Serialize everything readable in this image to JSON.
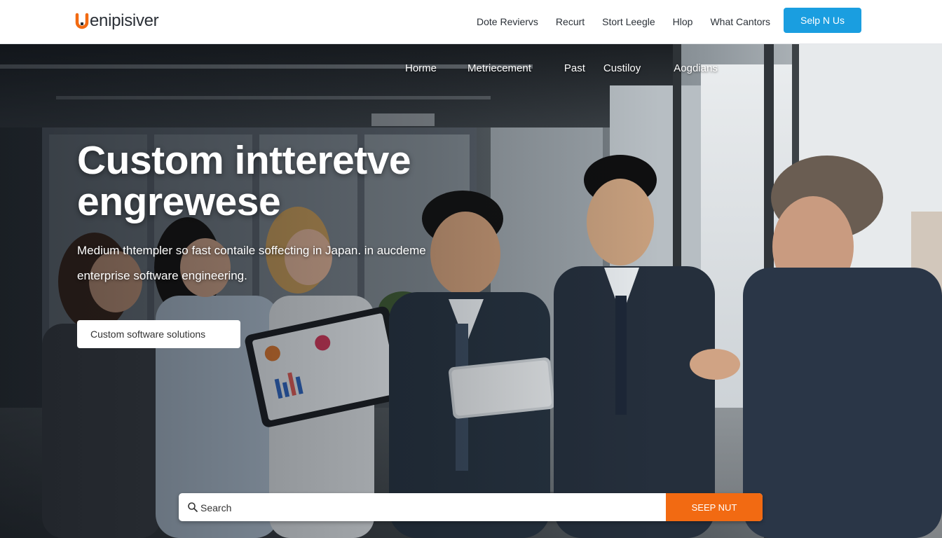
{
  "header": {
    "logo_text": "enipisiver",
    "nav": [
      "Dote Reviervs",
      "Recurt",
      "Stort Leegle",
      "Hlop",
      "What Cantors"
    ],
    "cta_label": "Selp N Us"
  },
  "hero": {
    "subnav": [
      "Horme",
      "Metriecement",
      "Past",
      "Custiloy",
      "Aogdians"
    ],
    "title": "Custom intteretve engrewese",
    "description": "Medium thtempler so fast contaile soffecting in Japan. in aucdeme enterprise software engineering.",
    "chip_placeholder": "Custom software solutions",
    "search_placeholder": "Search",
    "search_button": "SEEP NUT"
  },
  "colors": {
    "cta_blue": "#1a9ee0",
    "search_orange": "#f26a12",
    "logo_orange": "#f26a12"
  },
  "icons": [
    "logo-u-icon",
    "search-icon"
  ]
}
